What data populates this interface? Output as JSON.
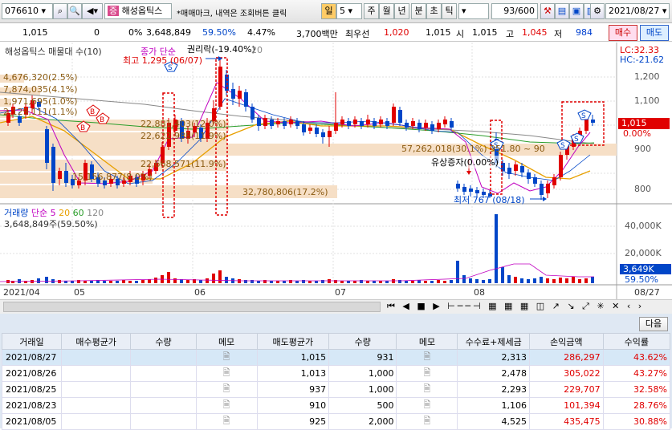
{
  "toolbar": {
    "code": "076610",
    "name": "해성옵틱스",
    "badge": "증",
    "hint": "*매매마크, 내역은 조회버튼 클릭",
    "period_selected": "일",
    "period_num": "5",
    "periods": [
      "주",
      "월",
      "년",
      "분",
      "초",
      "틱"
    ],
    "count": "93/600",
    "date": "2021/08/27"
  },
  "quote": {
    "price": "1,015",
    "change": "0",
    "change_rate": "0%",
    "volume": "3,648,849",
    "volume_ratio": "59.50%",
    "turnover_rate": "4.47%",
    "amount": "3,700백만",
    "best_ask_label": "최우선",
    "best_ask": "1,020",
    "best_bid": "1,015",
    "open_label": "시",
    "open": "1,015",
    "high_label": "고",
    "high": "1,045",
    "low_label": "저",
    "low": "984",
    "buy_btn": "매수",
    "sell_btn": "매도"
  },
  "chart": {
    "legend": "해성옵틱스 매물대 수(10)",
    "legend2": "종가 단순",
    "rights_label": "권리락(-19.40%)",
    "rights_value": "20",
    "lc": "LC:32.33",
    "hc": "HC:-21.62",
    "current_price_tag": "1,015",
    "current_pct_tag": "0.00%",
    "max_label": "최고 1,295 (06/07)",
    "min_label": "최저 767 (08/18)",
    "rights_issue_label": "유상증자(0.00%)",
    "y_ticks": [
      "1,200",
      "1,100",
      "1,000",
      "900",
      "800"
    ],
    "vp": [
      "4,676,320(2.5%)",
      "7,874,035(4.1%)",
      "1,971,695(1.0%)",
      "2,129,111(1.1%)",
      "22,881,403(12.0%)",
      "22,622,988(11.9%)",
      "22,668,571(11.9%)",
      "15,156,877(8.0%)",
      "32,780,806(17.2%)",
      "57,262,018(30.1%) 951.80 ~ 90"
    ],
    "vol_legend": "거래량",
    "vol_ma_label": "단순",
    "vol_ma": [
      "5",
      "20",
      "60",
      "120"
    ],
    "vol_value": "3,648,849주(59.50%)",
    "vol_ticks": [
      "40,000K",
      "20,000K"
    ],
    "vol_tag": "3,649K",
    "vol_pct_tag": "59.50%",
    "x_labels": [
      "2021/04",
      "05",
      "06",
      "07",
      "08"
    ],
    "x_right": "08/27"
  },
  "colors": {
    "up": "#e00000",
    "down": "#0046c8",
    "ma5": "#c000c0",
    "ma20": "#e8a000",
    "ma60": "#2a9d2a",
    "ma120": "#888888",
    "vp": "#f5dcc0"
  },
  "grid": {
    "next_btn": "다음",
    "headers": [
      "거래일",
      "매수평균가",
      "수량",
      "메모",
      "매도평균가",
      "수량",
      "메모",
      "수수료+제세금",
      "손익금액",
      "수익률"
    ],
    "rows": [
      [
        "2021/08/27",
        "",
        "",
        "",
        "1,015",
        "931",
        "",
        "2,313",
        "286,297",
        "43.62%"
      ],
      [
        "2021/08/26",
        "",
        "",
        "",
        "1,013",
        "1,000",
        "",
        "2,478",
        "305,022",
        "43.27%"
      ],
      [
        "2021/08/25",
        "",
        "",
        "",
        "937",
        "1,000",
        "",
        "2,293",
        "229,707",
        "32.58%"
      ],
      [
        "2021/08/23",
        "",
        "",
        "",
        "910",
        "500",
        "",
        "1,106",
        "101,394",
        "28.76%"
      ],
      [
        "2021/08/05",
        "",
        "",
        "",
        "925",
        "2,000",
        "",
        "4,525",
        "435,475",
        "30.88%"
      ]
    ]
  }
}
